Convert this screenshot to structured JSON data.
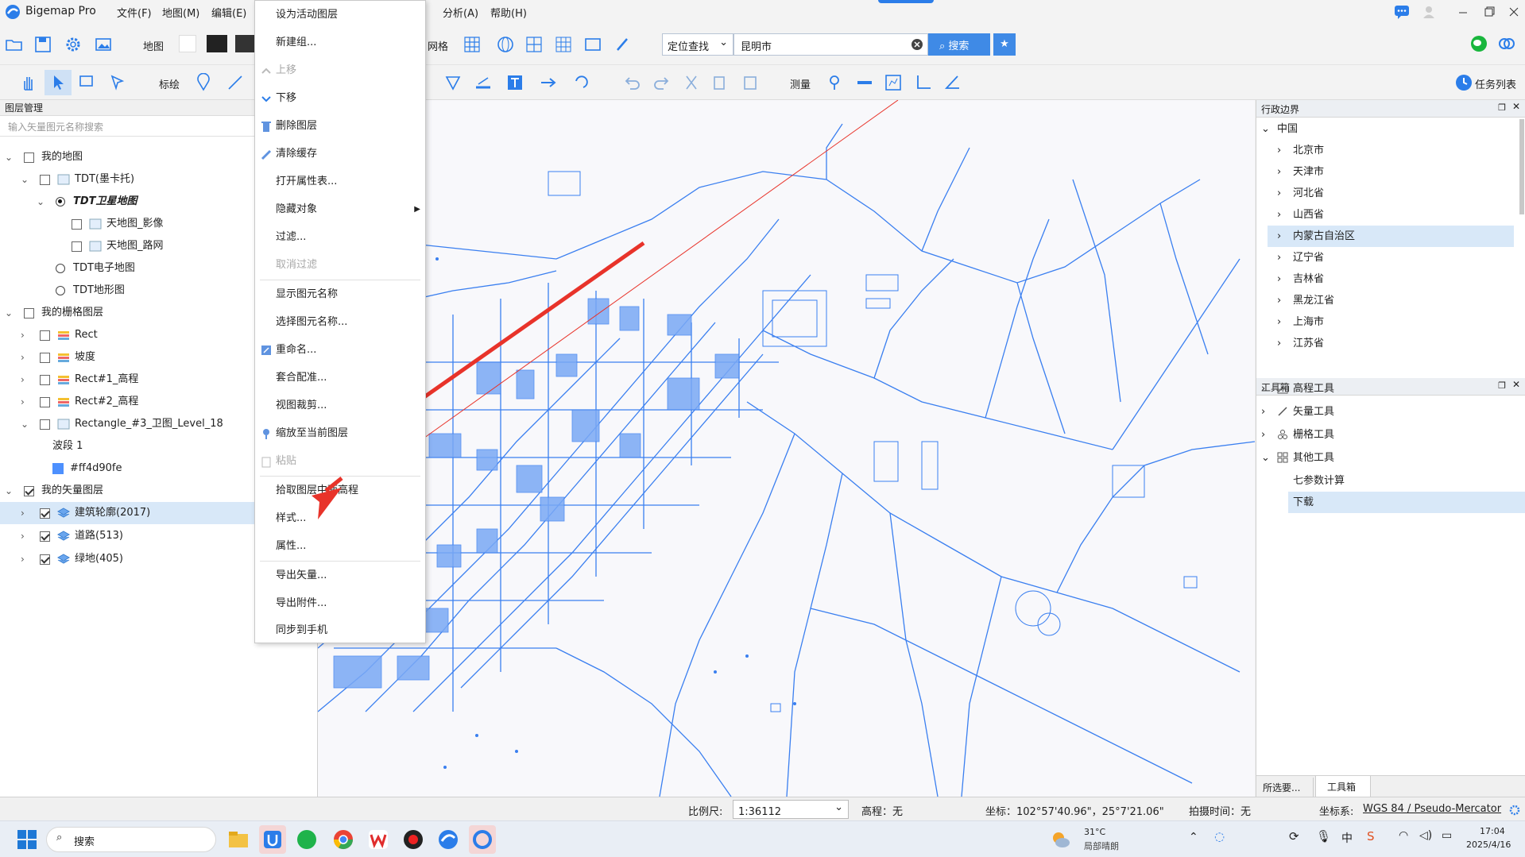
{
  "app": {
    "title": "Bigemap Pro",
    "menus": [
      "文件(F)",
      "地图(M)",
      "编辑(E)",
      "分析(A)",
      "帮助(H)"
    ]
  },
  "toolbar1": {
    "map_label": "地图",
    "grid_label": "网格",
    "search_mode": "定位查找",
    "search_value": "昆明市",
    "search_button": "搜索"
  },
  "toolbar2": {
    "draw_label": "标绘",
    "measure_label": "测量",
    "tasklist_label": "任务列表"
  },
  "left_panel": {
    "title": "图层管理",
    "search_placeholder": "输入矢量图元名称搜索",
    "tree": {
      "my_map": "我的地图",
      "tdt_mercator": "TDT(墨卡托)",
      "tdt_sat": "TDT卫星地图",
      "tdt_img": "天地图_影像",
      "tdt_road": "天地图_路网",
      "tdt_elec": "TDT电子地图",
      "tdt_terrain": "TDT地形图",
      "my_raster": "我的栅格图层",
      "rect": "Rect",
      "slope": "坡度",
      "rect1": "Rect#1_高程",
      "rect2": "Rect#2_高程",
      "rect3": "Rectangle_#3_卫图_Level_18",
      "band": "波段 1",
      "band_color": "#ff4d90fe",
      "my_vector": "我的矢量图层",
      "buildings": "建筑轮廓(2017)",
      "roads": "道路(513)",
      "green": "绿地(405)"
    }
  },
  "context_menu": {
    "items": {
      "set_active": "设为活动图层",
      "new_group": "新建组...",
      "move_up": "上移",
      "move_down": "下移",
      "delete": "删除图层",
      "clear_cache": "清除缓存",
      "open_attr": "打开属性表...",
      "hide": "隐藏对象",
      "filter": "过滤...",
      "cancel_filter": "取消过滤",
      "show_names": "显示图元名称",
      "select_names": "选择图元名称...",
      "rename": "重命名...",
      "match": "套合配准...",
      "crop": "视图裁剪...",
      "zoom": "缩放至当前图层",
      "paste": "粘贴",
      "pick_elev": "拾取图层中面高程",
      "style": "样式...",
      "props": "属性...",
      "export_vec": "导出矢量...",
      "export_att": "导出附件...",
      "sync": "同步到手机"
    }
  },
  "admin_panel": {
    "title": "行政边界",
    "root": "中国",
    "items": [
      "北京市",
      "天津市",
      "河北省",
      "山西省",
      "内蒙古自治区",
      "辽宁省",
      "吉林省",
      "黑龙江省",
      "上海市",
      "江苏省"
    ]
  },
  "toolbox": {
    "title": "工具箱",
    "items": [
      "高程工具",
      "矢量工具",
      "栅格工具",
      "其他工具"
    ],
    "sub_items": [
      "七参数计算",
      "下载"
    ],
    "tabs": [
      "所选要...",
      "工具箱"
    ]
  },
  "status": {
    "scale_label": "比例尺:",
    "scale_value": "1:36112",
    "elev": "高程：无",
    "coord": "坐标：102°57'40.96\"，25°7'21.06\"",
    "shot": "拍摄时间：无",
    "crs_label": "坐标系:",
    "crs_value": "WGS 84 / Pseudo-Mercator"
  },
  "taskbar": {
    "search": "搜索",
    "temp": "31°C",
    "weather": "局部晴朗",
    "time": "17:04",
    "date": "2025/4/16"
  },
  "colors": {
    "accent": "#2b7de9",
    "map_line": "#3a7ff0",
    "arrow": "#e8332a",
    "selection": "#d8e8f8"
  }
}
